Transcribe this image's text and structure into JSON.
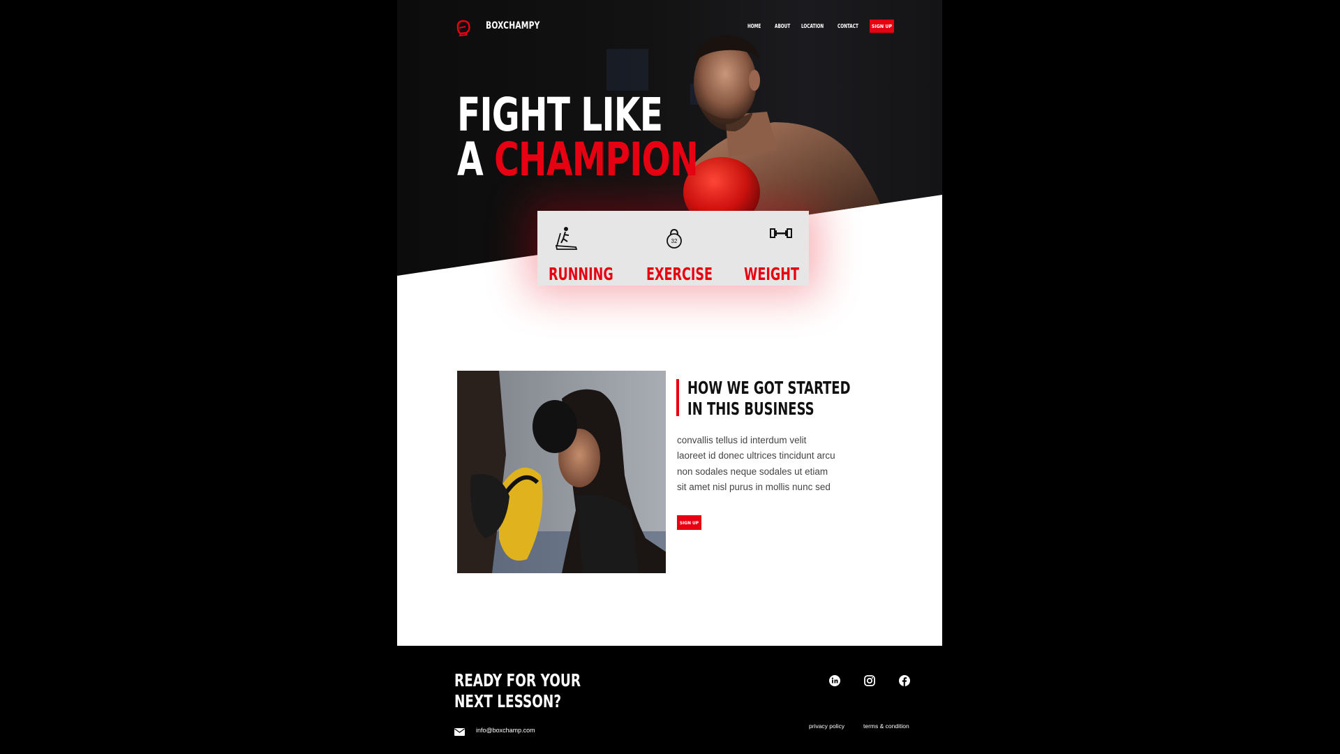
{
  "brand": {
    "name": "BOXCHAMPY"
  },
  "nav": {
    "items": [
      "HOME",
      "ABOUT",
      "LOCATION",
      "CONTACT"
    ],
    "signup": "SIGN UP"
  },
  "hero": {
    "line1": "FIGHT LIKE",
    "line2_prefix": "A ",
    "line2_highlight": "CHAMPION"
  },
  "features": [
    {
      "label": "RUNNING",
      "icon": "treadmill-icon"
    },
    {
      "label": "EXERCISE",
      "icon": "kettlebell-icon",
      "icon_text": "32"
    },
    {
      "label": "WEIGHT",
      "icon": "dumbbell-icon"
    }
  ],
  "about": {
    "title_line1": "HOW WE GOT STARTED",
    "title_line2": "IN THIS BUSINESS",
    "text": "convallis tellus id interdum velit laoreet id donec ultrices tincidunt arcu non sodales neque sodales ut etiam sit amet nisl purus in mollis nunc sed",
    "signup": "SIGN UP"
  },
  "footer": {
    "title_line1": "READY FOR YOUR",
    "title_line2": "NEXT LESSON?",
    "email": "info@boxchamp.com",
    "social": [
      "linkedin-icon",
      "instagram-icon",
      "facebook-icon"
    ],
    "links": [
      "privacy policy",
      "terms & condition"
    ]
  },
  "colors": {
    "accent": "#e60012",
    "dark": "#111111",
    "card": "#e6e6e6"
  }
}
